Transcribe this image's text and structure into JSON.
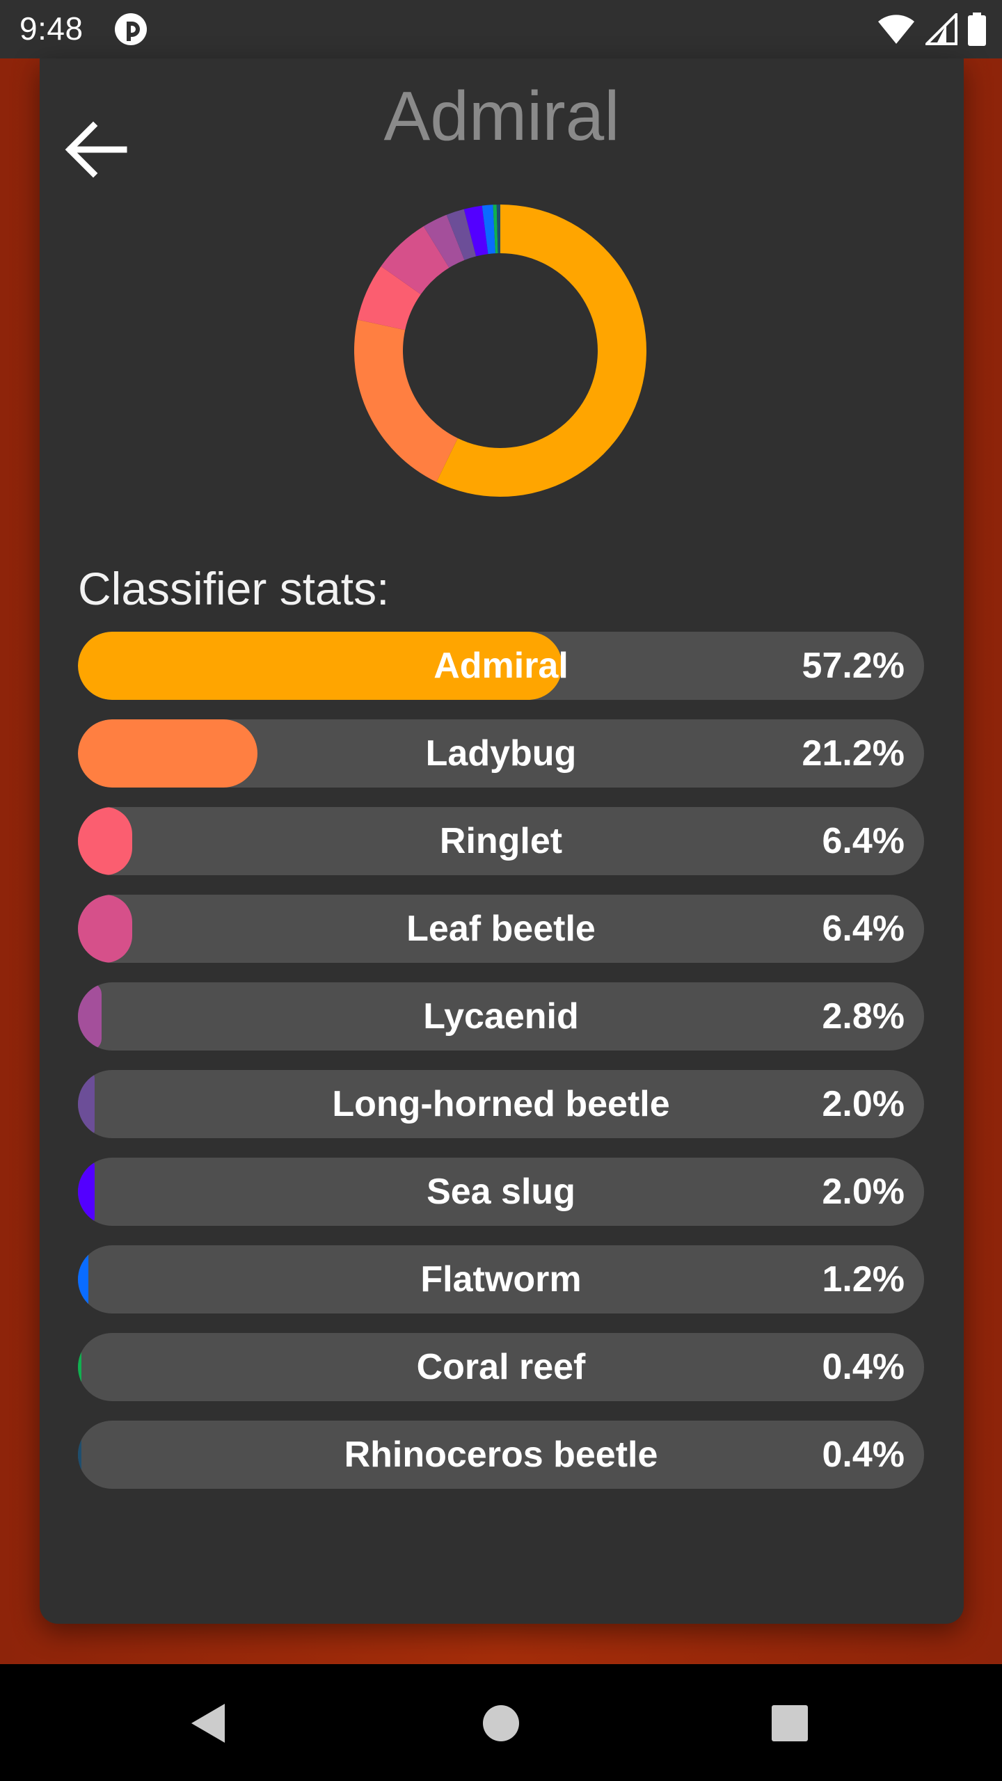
{
  "status_bar": {
    "time": "9:48"
  },
  "header": {
    "title": "Admiral",
    "back_icon": "arrow-left-icon"
  },
  "stats": {
    "heading": "Classifier stats:",
    "items": [
      {
        "label": "Admiral",
        "value": "57.2%",
        "fraction": 0.572,
        "color": "#ffa500"
      },
      {
        "label": "Ladybug",
        "value": "21.2%",
        "fraction": 0.212,
        "color": "#ff7f41"
      },
      {
        "label": "Ringlet",
        "value": "6.4%",
        "fraction": 0.064,
        "color": "#fb5e70"
      },
      {
        "label": "Leaf beetle",
        "value": "6.4%",
        "fraction": 0.064,
        "color": "#d6508a"
      },
      {
        "label": "Lycaenid",
        "value": "2.8%",
        "fraction": 0.028,
        "color": "#a44f9b"
      },
      {
        "label": "Long-horned beetle",
        "value": "2.0%",
        "fraction": 0.02,
        "color": "#6c4e98"
      },
      {
        "label": "Sea slug",
        "value": "2.0%",
        "fraction": 0.02,
        "color": "#5300ff"
      },
      {
        "label": "Flatworm",
        "value": "1.2%",
        "fraction": 0.012,
        "color": "#0a6cff"
      },
      {
        "label": "Coral reef",
        "value": "0.4%",
        "fraction": 0.004,
        "color": "#10b050"
      },
      {
        "label": "Rhinoceros beetle",
        "value": "0.4%",
        "fraction": 0.004,
        "color": "#1e4e6e"
      }
    ]
  },
  "nav": {
    "back_icon": "triangle-back-icon",
    "home_icon": "circle-home-icon",
    "recents_icon": "square-recents-icon"
  }
}
